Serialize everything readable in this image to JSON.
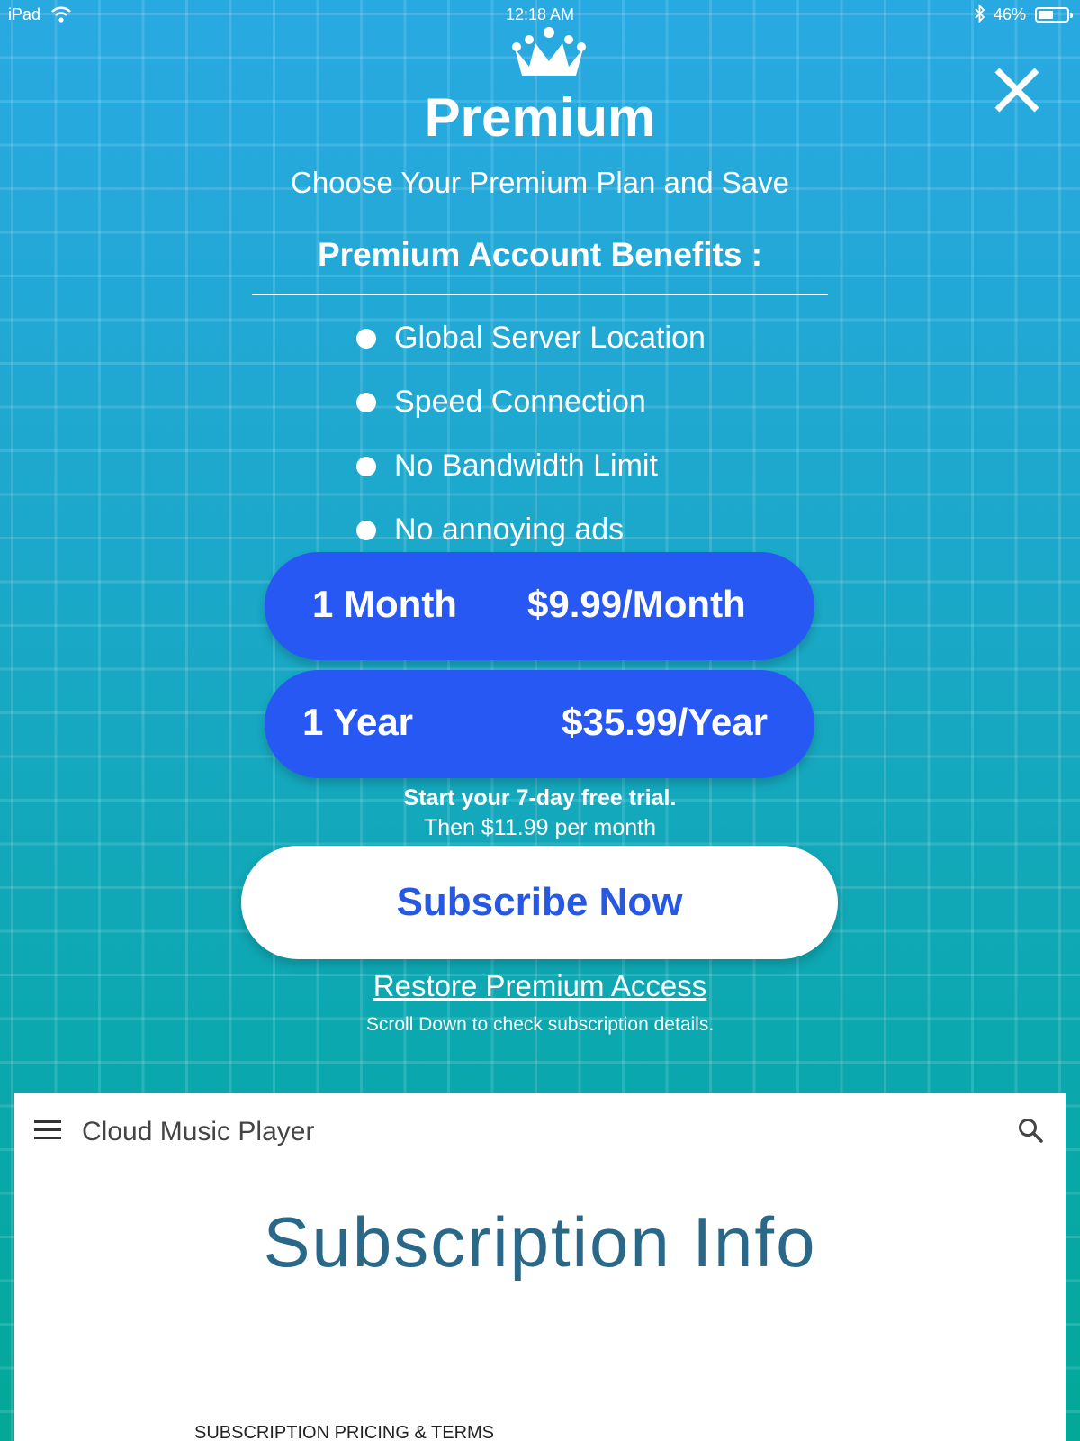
{
  "status_bar": {
    "device": "iPad",
    "time": "12:18 AM",
    "battery": "46%",
    "battery_level": 0.46,
    "icons": [
      "wifi-icon",
      "bluetooth-icon",
      "battery-icon"
    ]
  },
  "header": {
    "icon": "crown-icon",
    "title": "Premium",
    "subtitle": "Choose Your Premium Plan and Save",
    "close_icon": "close-icon"
  },
  "benefits": {
    "heading": "Premium Account Benefits :",
    "items": [
      "Global Server Location",
      "Speed Connection",
      "No Bandwidth Limit",
      "No annoying ads"
    ]
  },
  "plans": [
    {
      "name": "1 Month",
      "price": "$9.99/Month"
    },
    {
      "name": "1 Year",
      "price": "$35.99/Year"
    }
  ],
  "trial": {
    "headline": "Start your 7-day free trial.",
    "then": "Then $11.99 per month"
  },
  "actions": {
    "subscribe": "Subscribe Now",
    "restore": "Restore Premium Access",
    "scroll_hint": "Scroll Down to check subscription details."
  },
  "web_content": {
    "menu_icon": "hamburger-menu-icon",
    "site_title": "Cloud Music Player",
    "search_icon": "search-icon",
    "heading": "Subscription Info",
    "section_label": "SUBSCRIPTION PRICING & TERMS"
  },
  "colors": {
    "background_top": "#29a9e2",
    "background_bottom": "#03a898",
    "plan_button": "#2758f4",
    "subscribe_text": "#2758e4",
    "heading_text": "#2a6889"
  }
}
